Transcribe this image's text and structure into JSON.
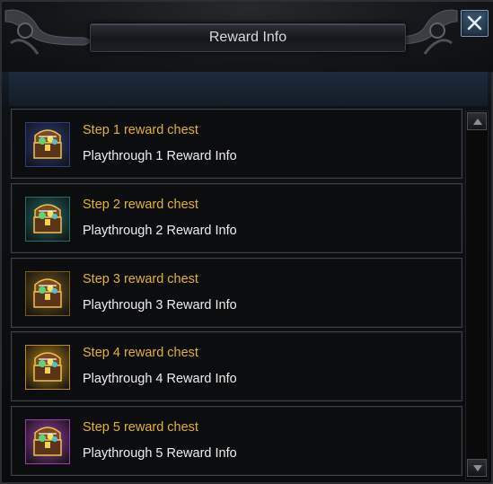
{
  "window": {
    "title": "Reward Info"
  },
  "rewards": [
    {
      "title": "Step 1 reward chest",
      "subtitle": "Playthrough 1 Reward Info",
      "icon": "blue-chest-icon",
      "bg": "#2c3e8a"
    },
    {
      "title": "Step 2 reward chest",
      "subtitle": "Playthrough 2 Reward Info",
      "icon": "teal-chest-icon",
      "bg": "#1f6f6a"
    },
    {
      "title": "Step 3 reward chest",
      "subtitle": "Playthrough 3 Reward Info",
      "icon": "bronze-chest-icon",
      "bg": "#7a5a18"
    },
    {
      "title": "Step 4 reward chest",
      "subtitle": "Playthrough 4 Reward Info",
      "icon": "gold-chest-icon",
      "bg": "#c08a14"
    },
    {
      "title": "Step 5 reward chest",
      "subtitle": "Playthrough 5 Reward Info",
      "icon": "purple-chest-icon",
      "bg": "#a23bb0"
    }
  ],
  "colors": {
    "title_text": "#e2b32b",
    "body_text": "#eeeeee",
    "close_button": "#2e4a66"
  }
}
